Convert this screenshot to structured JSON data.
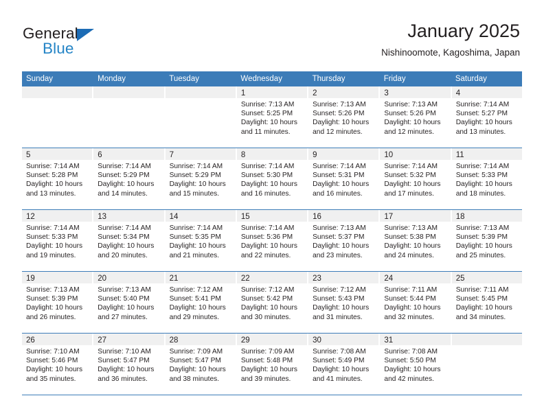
{
  "brand": {
    "name_top": "General",
    "name_bottom": "Blue",
    "accent_color": "#2484c6",
    "triangle_color": "#1c6cb5"
  },
  "header": {
    "title": "January 2025",
    "subtitle": "Nishinoomote, Kagoshima, Japan"
  },
  "theme": {
    "header_row_bg": "#3c7cb8",
    "day_band_bg": "#f0f0f0",
    "text_color": "#231f20"
  },
  "weekdays": [
    "Sunday",
    "Monday",
    "Tuesday",
    "Wednesday",
    "Thursday",
    "Friday",
    "Saturday"
  ],
  "weeks": [
    [
      {
        "day": "",
        "empty": true
      },
      {
        "day": "",
        "empty": true
      },
      {
        "day": "",
        "empty": true
      },
      {
        "day": "1",
        "sunrise": "Sunrise: 7:13 AM",
        "sunset": "Sunset: 5:25 PM",
        "daylight": "Daylight: 10 hours and 11 minutes."
      },
      {
        "day": "2",
        "sunrise": "Sunrise: 7:13 AM",
        "sunset": "Sunset: 5:26 PM",
        "daylight": "Daylight: 10 hours and 12 minutes."
      },
      {
        "day": "3",
        "sunrise": "Sunrise: 7:13 AM",
        "sunset": "Sunset: 5:26 PM",
        "daylight": "Daylight: 10 hours and 12 minutes."
      },
      {
        "day": "4",
        "sunrise": "Sunrise: 7:14 AM",
        "sunset": "Sunset: 5:27 PM",
        "daylight": "Daylight: 10 hours and 13 minutes."
      }
    ],
    [
      {
        "day": "5",
        "sunrise": "Sunrise: 7:14 AM",
        "sunset": "Sunset: 5:28 PM",
        "daylight": "Daylight: 10 hours and 13 minutes."
      },
      {
        "day": "6",
        "sunrise": "Sunrise: 7:14 AM",
        "sunset": "Sunset: 5:29 PM",
        "daylight": "Daylight: 10 hours and 14 minutes."
      },
      {
        "day": "7",
        "sunrise": "Sunrise: 7:14 AM",
        "sunset": "Sunset: 5:29 PM",
        "daylight": "Daylight: 10 hours and 15 minutes."
      },
      {
        "day": "8",
        "sunrise": "Sunrise: 7:14 AM",
        "sunset": "Sunset: 5:30 PM",
        "daylight": "Daylight: 10 hours and 16 minutes."
      },
      {
        "day": "9",
        "sunrise": "Sunrise: 7:14 AM",
        "sunset": "Sunset: 5:31 PM",
        "daylight": "Daylight: 10 hours and 16 minutes."
      },
      {
        "day": "10",
        "sunrise": "Sunrise: 7:14 AM",
        "sunset": "Sunset: 5:32 PM",
        "daylight": "Daylight: 10 hours and 17 minutes."
      },
      {
        "day": "11",
        "sunrise": "Sunrise: 7:14 AM",
        "sunset": "Sunset: 5:33 PM",
        "daylight": "Daylight: 10 hours and 18 minutes."
      }
    ],
    [
      {
        "day": "12",
        "sunrise": "Sunrise: 7:14 AM",
        "sunset": "Sunset: 5:33 PM",
        "daylight": "Daylight: 10 hours and 19 minutes."
      },
      {
        "day": "13",
        "sunrise": "Sunrise: 7:14 AM",
        "sunset": "Sunset: 5:34 PM",
        "daylight": "Daylight: 10 hours and 20 minutes."
      },
      {
        "day": "14",
        "sunrise": "Sunrise: 7:14 AM",
        "sunset": "Sunset: 5:35 PM",
        "daylight": "Daylight: 10 hours and 21 minutes."
      },
      {
        "day": "15",
        "sunrise": "Sunrise: 7:14 AM",
        "sunset": "Sunset: 5:36 PM",
        "daylight": "Daylight: 10 hours and 22 minutes."
      },
      {
        "day": "16",
        "sunrise": "Sunrise: 7:13 AM",
        "sunset": "Sunset: 5:37 PM",
        "daylight": "Daylight: 10 hours and 23 minutes."
      },
      {
        "day": "17",
        "sunrise": "Sunrise: 7:13 AM",
        "sunset": "Sunset: 5:38 PM",
        "daylight": "Daylight: 10 hours and 24 minutes."
      },
      {
        "day": "18",
        "sunrise": "Sunrise: 7:13 AM",
        "sunset": "Sunset: 5:39 PM",
        "daylight": "Daylight: 10 hours and 25 minutes."
      }
    ],
    [
      {
        "day": "19",
        "sunrise": "Sunrise: 7:13 AM",
        "sunset": "Sunset: 5:39 PM",
        "daylight": "Daylight: 10 hours and 26 minutes."
      },
      {
        "day": "20",
        "sunrise": "Sunrise: 7:13 AM",
        "sunset": "Sunset: 5:40 PM",
        "daylight": "Daylight: 10 hours and 27 minutes."
      },
      {
        "day": "21",
        "sunrise": "Sunrise: 7:12 AM",
        "sunset": "Sunset: 5:41 PM",
        "daylight": "Daylight: 10 hours and 29 minutes."
      },
      {
        "day": "22",
        "sunrise": "Sunrise: 7:12 AM",
        "sunset": "Sunset: 5:42 PM",
        "daylight": "Daylight: 10 hours and 30 minutes."
      },
      {
        "day": "23",
        "sunrise": "Sunrise: 7:12 AM",
        "sunset": "Sunset: 5:43 PM",
        "daylight": "Daylight: 10 hours and 31 minutes."
      },
      {
        "day": "24",
        "sunrise": "Sunrise: 7:11 AM",
        "sunset": "Sunset: 5:44 PM",
        "daylight": "Daylight: 10 hours and 32 minutes."
      },
      {
        "day": "25",
        "sunrise": "Sunrise: 7:11 AM",
        "sunset": "Sunset: 5:45 PM",
        "daylight": "Daylight: 10 hours and 34 minutes."
      }
    ],
    [
      {
        "day": "26",
        "sunrise": "Sunrise: 7:10 AM",
        "sunset": "Sunset: 5:46 PM",
        "daylight": "Daylight: 10 hours and 35 minutes."
      },
      {
        "day": "27",
        "sunrise": "Sunrise: 7:10 AM",
        "sunset": "Sunset: 5:47 PM",
        "daylight": "Daylight: 10 hours and 36 minutes."
      },
      {
        "day": "28",
        "sunrise": "Sunrise: 7:09 AM",
        "sunset": "Sunset: 5:47 PM",
        "daylight": "Daylight: 10 hours and 38 minutes."
      },
      {
        "day": "29",
        "sunrise": "Sunrise: 7:09 AM",
        "sunset": "Sunset: 5:48 PM",
        "daylight": "Daylight: 10 hours and 39 minutes."
      },
      {
        "day": "30",
        "sunrise": "Sunrise: 7:08 AM",
        "sunset": "Sunset: 5:49 PM",
        "daylight": "Daylight: 10 hours and 41 minutes."
      },
      {
        "day": "31",
        "sunrise": "Sunrise: 7:08 AM",
        "sunset": "Sunset: 5:50 PM",
        "daylight": "Daylight: 10 hours and 42 minutes."
      },
      {
        "day": "",
        "empty": true
      }
    ]
  ]
}
